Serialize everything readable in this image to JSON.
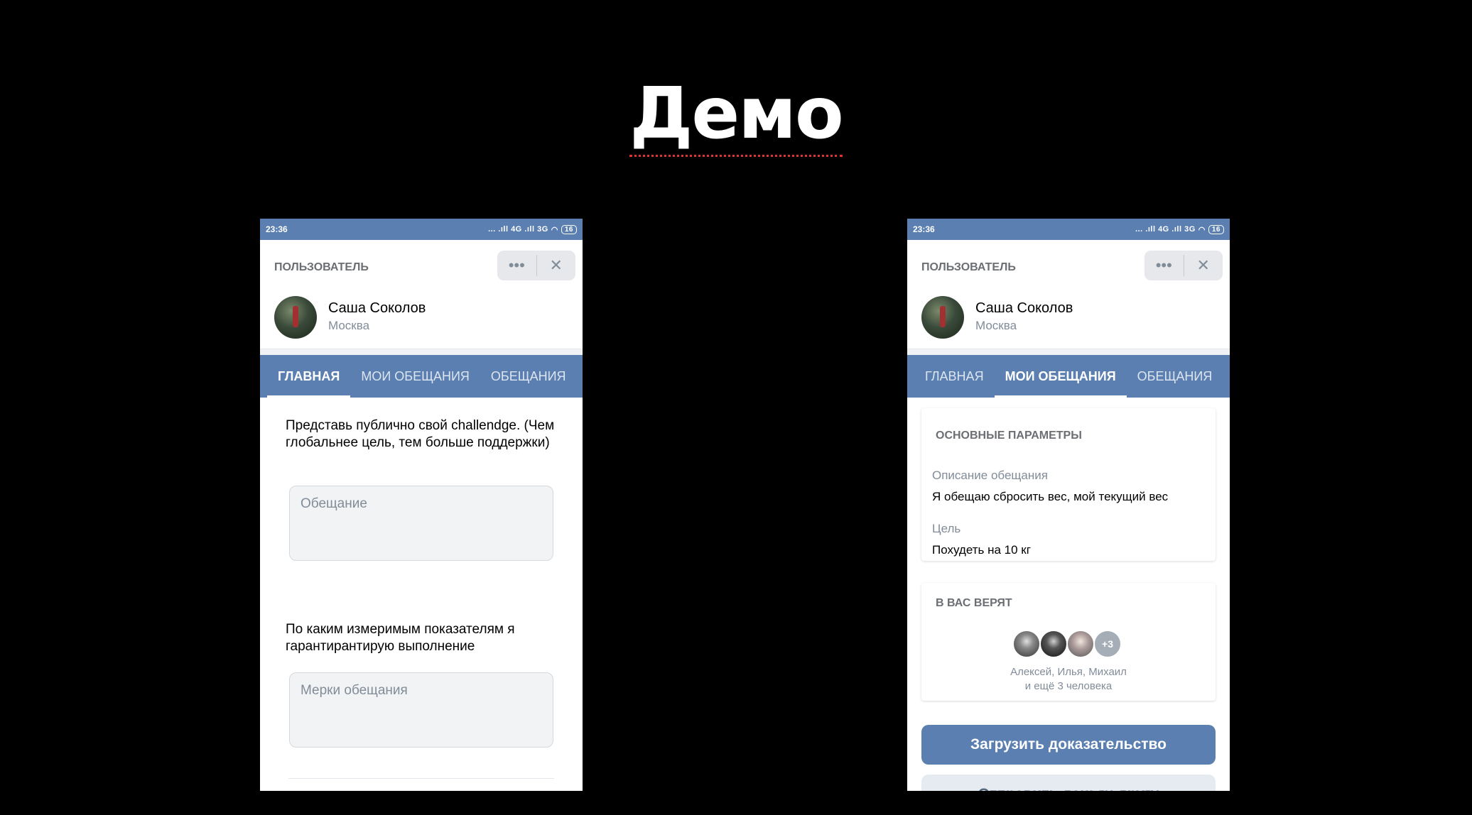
{
  "slide": {
    "title": "Демо"
  },
  "status": {
    "time": "23:36",
    "network": "... .ıll 4G .ıll 3G",
    "battery": "16"
  },
  "header": {
    "label": "ПОЛЬЗОВАТЕЛЬ",
    "more": "•••",
    "close": "✕"
  },
  "user": {
    "name": "Саша Соколов",
    "city": "Москва"
  },
  "tabs": [
    "ГЛАВНАЯ",
    "МОИ ОБЕЩАНИЯ",
    "ОБЕЩАНИЯ"
  ],
  "left": {
    "active_tab": 0,
    "prompt1": "Представь публично свой challendge. (Чем глобальнее цель, тем больше поддержки)",
    "field1_placeholder": "Обещание",
    "prompt2": "По каким измеримым показателям я гарантирантирую выполнение",
    "field2_placeholder": "Мерки обещания"
  },
  "right": {
    "active_tab": 1,
    "section_params": "ОСНОВНЫЕ ПАРАМЕТРЫ",
    "desc_label": "Описание обещания",
    "desc_value": "Я обещаю сбросить вес, мой текущий вес",
    "goal_label": "Цель",
    "goal_value": "Похудеть на 10 кг",
    "section_believers": "В ВАС ВЕРЯТ",
    "believers_more": "+3",
    "believers_names": "Алексей, Илья, Михаил",
    "believers_more_text": "и ещё 3 человека",
    "upload_button": "Загрузить доказательство",
    "secondary_button": "Отправить деньги другу"
  }
}
